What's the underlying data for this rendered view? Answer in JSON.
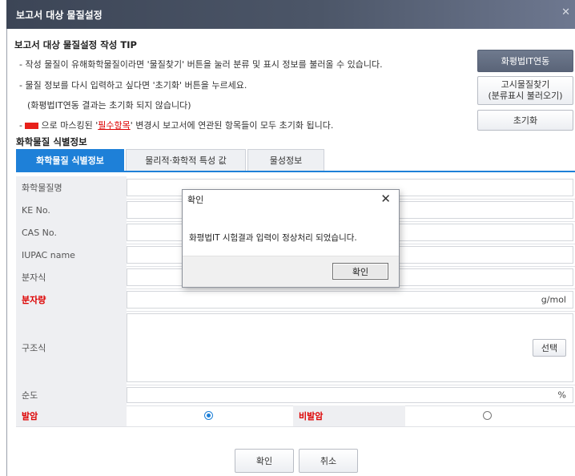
{
  "window": {
    "title": "보고서 대상 물질설정",
    "close_glyph": "✕"
  },
  "tip": {
    "title": "보고서 대상 물질설정 작성 TIP",
    "line1": "- 작성 물질이 유해화학물질이라면 '물질찾기' 버튼을 눌러 분류 및 표시 정보를 불러올 수 있습니다.",
    "line2": "- 물질 정보를 다시 입력하고 싶다면 '초기화' 버튼을 누르세요.",
    "line3": "(화평법IT연동 결과는 초기화 되지 않습니다)",
    "line4_prefix": "-",
    "line4_mid": "으로 마스킹된 '",
    "line4_link": "필수항목",
    "line4_suffix": "' 변경시 보고서에 연관된 항목들이 모두 초기화 됩니다."
  },
  "side_buttons": {
    "link_it": "화평법IT연동",
    "search_line1": "고시물질찾기",
    "search_line2": "(분류표시 불러오기)",
    "reset": "초기화"
  },
  "section": {
    "title": "화학물질 식별정보"
  },
  "tabs": [
    {
      "label": "화학물질 식별정보",
      "active": true
    },
    {
      "label": "물리적·화학적 특성 값",
      "active": false
    },
    {
      "label": "물성정보",
      "active": false
    }
  ],
  "form": {
    "chem_name": {
      "label": "화학물질명",
      "value": ""
    },
    "ke_no": {
      "label": "KE No.",
      "value": ""
    },
    "cas_no": {
      "label": "CAS No.",
      "value": ""
    },
    "iupac": {
      "label": "IUPAC name",
      "value": ""
    },
    "formula": {
      "label": "분자식",
      "value": ""
    },
    "mol_weight": {
      "label": "분자량",
      "value": "",
      "unit": "g/mol"
    },
    "structure": {
      "label": "구조식",
      "select_button": "선택"
    },
    "purity": {
      "label": "순도",
      "value": "",
      "unit": "%"
    },
    "carcinogen": {
      "label": "발암",
      "selected": true
    },
    "non_carcinogen": {
      "label": "비발암",
      "selected": false
    }
  },
  "footer": {
    "ok": "확인",
    "cancel": "취소"
  },
  "dialog": {
    "title": "확인",
    "close_glyph": "✕",
    "message": "화평법IT 시험결과 입력이 정상처리 되었습니다.",
    "ok": "확인"
  },
  "colors": {
    "accent": "#1e80d8",
    "required": "#dd0000",
    "titlebar": "#4c5668"
  }
}
